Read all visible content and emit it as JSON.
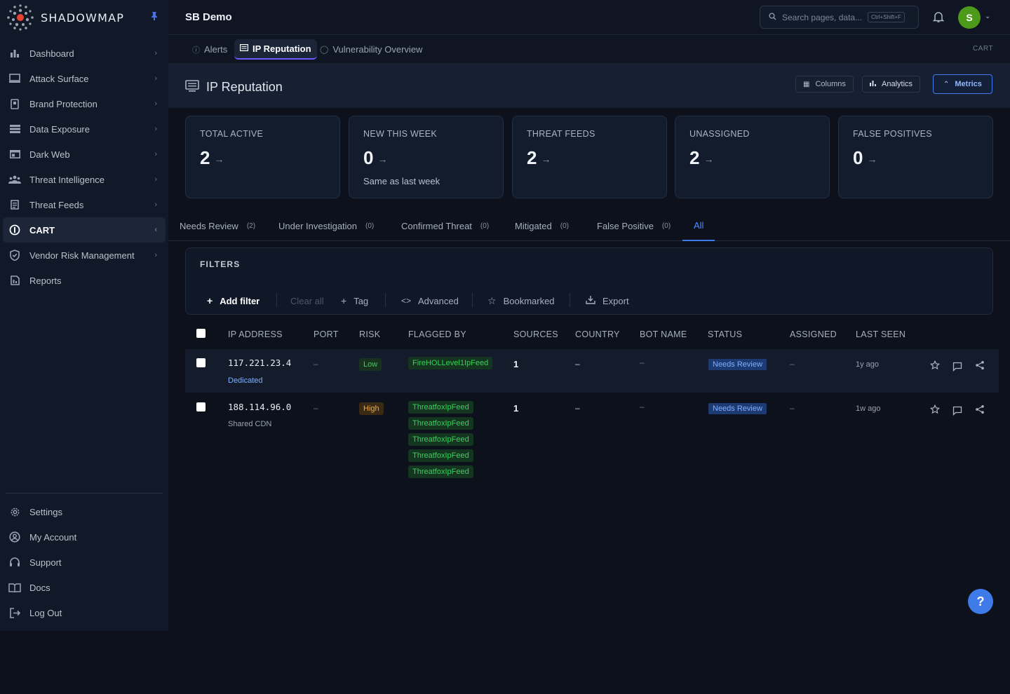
{
  "app": {
    "brand": "SHADOWMAP",
    "workspace": "SB Demo"
  },
  "sidebar": {
    "items": [
      {
        "label": "Dashboard",
        "icon": "bar-chart-icon"
      },
      {
        "label": "Attack Surface",
        "icon": "monitor-icon"
      },
      {
        "label": "Brand Protection",
        "icon": "badge-icon"
      },
      {
        "label": "Data Exposure",
        "icon": "stack-icon"
      },
      {
        "label": "Dark Web",
        "icon": "browser-icon"
      },
      {
        "label": "Threat Intelligence",
        "icon": "people-icon"
      },
      {
        "label": "Threat Feeds",
        "icon": "document-icon"
      },
      {
        "label": "CART",
        "icon": "info-circle-icon",
        "active": true
      },
      {
        "label": "Vendor Risk Management",
        "icon": "shield-check-icon"
      },
      {
        "label": "Reports",
        "icon": "report-icon"
      }
    ],
    "bottom": [
      {
        "label": "Settings",
        "icon": "gear-icon"
      },
      {
        "label": "My Account",
        "icon": "user-circle-icon"
      },
      {
        "label": "Support",
        "icon": "headset-icon"
      },
      {
        "label": "Docs",
        "icon": "book-icon"
      },
      {
        "label": "Log Out",
        "icon": "logout-icon"
      }
    ]
  },
  "topbar": {
    "search_placeholder": "Search pages, data...",
    "shortcut": "Ctrl+Shift+F",
    "avatar_initial": "S"
  },
  "page_tabs": [
    {
      "label": "Alerts"
    },
    {
      "label": "IP Reputation",
      "active": true
    },
    {
      "label": "Vulnerability Overview"
    }
  ],
  "breadcrumb_right": "CART",
  "header": {
    "title": "IP Reputation",
    "columns_label": "Columns",
    "analytics_label": "Analytics",
    "metrics_label": "Metrics"
  },
  "cards": [
    {
      "title": "TOTAL ACTIVE",
      "value": "2",
      "sub": ""
    },
    {
      "title": "NEW THIS WEEK",
      "value": "0",
      "sub": "Same as last week"
    },
    {
      "title": "THREAT FEEDS",
      "value": "2",
      "sub": ""
    },
    {
      "title": "UNASSIGNED",
      "value": "2",
      "sub": ""
    },
    {
      "title": "FALSE POSITIVES",
      "value": "0",
      "sub": ""
    }
  ],
  "status_tabs": [
    {
      "label": "Needs Review",
      "count": "(2)"
    },
    {
      "label": "Under Investigation",
      "count": "(0)"
    },
    {
      "label": "Confirmed Threat",
      "count": "(0)"
    },
    {
      "label": "Mitigated",
      "count": "(0)"
    },
    {
      "label": "False Positive",
      "count": "(0)"
    },
    {
      "label": "All",
      "count": ""
    }
  ],
  "filters": {
    "title": "FILTERS",
    "add_filter": "Add filter",
    "clear_all": "Clear all",
    "tag": "Tag",
    "advanced": "Advanced",
    "bookmarked": "Bookmarked",
    "export": "Export"
  },
  "table": {
    "columns": [
      "IP ADDRESS",
      "PORT",
      "RISK",
      "FLAGGED BY",
      "SOURCES",
      "COUNTRY",
      "BOT NAME",
      "STATUS",
      "ASSIGNED",
      "LAST SEEN"
    ],
    "rows": [
      {
        "ip": "117.221.23.4",
        "type": "Dedicated",
        "port": "–",
        "risk": "Low",
        "flagged_by": [
          "FireHOLLevel1IpFeed"
        ],
        "sources": "1",
        "country": "–",
        "bot_name": "–",
        "status": "Needs Review",
        "assigned": "–",
        "last_seen": "1y ago"
      },
      {
        "ip": "188.114.96.0",
        "type": "Shared CDN",
        "port": "–",
        "risk": "High",
        "flagged_by": [
          "ThreatfoxIpFeed",
          "ThreatfoxIpFeed",
          "ThreatfoxIpFeed",
          "ThreatfoxIpFeed",
          "ThreatfoxIpFeed"
        ],
        "sources": "1",
        "country": "–",
        "bot_name": "–",
        "status": "Needs Review",
        "assigned": "–",
        "last_seen": "1w ago"
      }
    ]
  },
  "help_label": "?",
  "colors": {
    "accent": "#3f7be8",
    "risk_low": "#3ccf5a",
    "risk_high": "#f6a53a",
    "feed": "#37d35b",
    "status": "#7fb0ff"
  }
}
